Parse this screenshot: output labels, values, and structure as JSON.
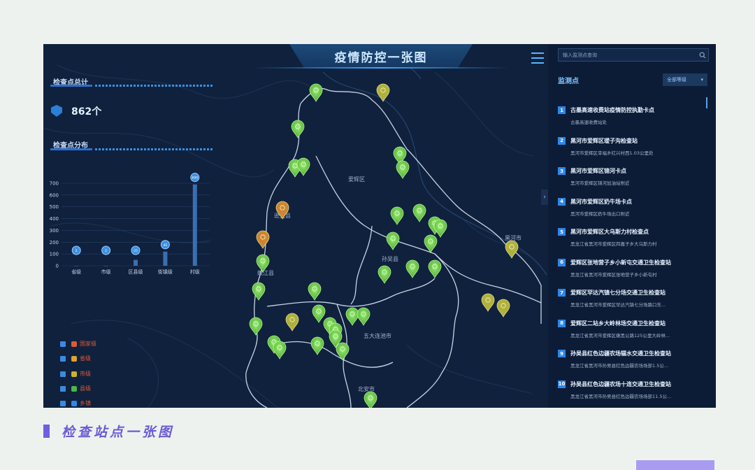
{
  "header": {
    "title": "疫情防控一张图"
  },
  "summary": {
    "title": "检查点总计",
    "total": "862个"
  },
  "distribution": {
    "title": "检查点分布"
  },
  "chart_data": {
    "type": "bar",
    "categories": [
      "省级",
      "市级",
      "区县级",
      "街镇级",
      "村级"
    ],
    "values": [
      0,
      0,
      50,
      120,
      690
    ],
    "badges": [
      "2",
      "2",
      "25",
      "45",
      "690"
    ],
    "ylim": [
      0,
      700
    ],
    "yticks": [
      "0",
      "100",
      "200",
      "300",
      "400",
      "500",
      "600",
      "700"
    ]
  },
  "legend": [
    {
      "label": "国家级",
      "color": "#d85c3a"
    },
    {
      "label": "省级",
      "color": "#e0a22e"
    },
    {
      "label": "市级",
      "color": "#c9b42a"
    },
    {
      "label": "县级",
      "color": "#47b84a"
    },
    {
      "label": "乡镇",
      "color": "#2f86e8"
    }
  ],
  "map": {
    "labels": [
      "爱辉区",
      "逊克县",
      "孙吴县",
      "五大连池市",
      "北安市",
      "嫩江县",
      "黑河市"
    ]
  },
  "search": {
    "placeholder": "输入监测点查询"
  },
  "right_panel": {
    "title": "监测点",
    "filter_label": "全部等级",
    "collapse_glyph": "›"
  },
  "stations": [
    {
      "num": "1",
      "name": "古墨高速收费站疫情防控执勤卡点",
      "addr": "古墨高速收费站处"
    },
    {
      "num": "2",
      "name": "黑河市爱辉区瑷子沟检查站",
      "addr": "黑河市爱辉区幸福乡红兴村西1.03公里处"
    },
    {
      "num": "3",
      "name": "黑河市爱辉区锦河卡点",
      "addr": "黑河市爱辉区锦河加油站附近"
    },
    {
      "num": "4",
      "name": "黑河市爱辉区奶牛场卡点",
      "addr": "黑河市爱辉区奶牛场出口附近"
    },
    {
      "num": "5",
      "name": "黑河市爱辉区大乌斯力村检查点",
      "addr": "黑龙江省黑河市爱辉区四嘉子乡大乌斯力村"
    },
    {
      "num": "6",
      "name": "爱辉区张地营子乡小新屯交通卫生检查站",
      "addr": "黑龙江省黑河市爱辉区张地营子乡小新屯村"
    },
    {
      "num": "7",
      "name": "爱辉区罕达汽镇七分场交通卫生检查站",
      "addr": "黑龙江省黑河市爱辉区罕达汽镇七分场路口东..."
    },
    {
      "num": "8",
      "name": "爱辉区二站乡大岭林场交通卫生检查站",
      "addr": "黑龙江省黑河市爱辉区嫩黑公路125公里大岭林..."
    },
    {
      "num": "9",
      "name": "孙吴县红色边疆农场辐水交通卫生检查站",
      "addr": "黑龙江省黑河市孙吴县红色边疆农场场部1.5公..."
    },
    {
      "num": "10",
      "name": "孙吴县红色边疆农场十连交通卫生检查站",
      "addr": "黑龙江省黑河市孙吴县红色边疆农场场部11.5公..."
    }
  ],
  "caption": "检查站点一张图"
}
